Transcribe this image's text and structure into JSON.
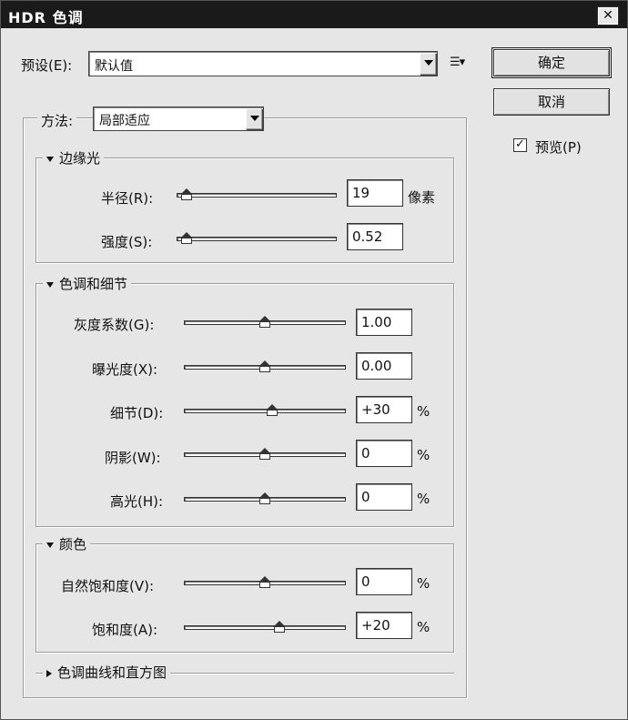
{
  "window": {
    "title": "HDR 色调",
    "close": "✕"
  },
  "preset": {
    "label": "预设(E):",
    "value": "默认值"
  },
  "buttons": {
    "ok": "确定",
    "cancel": "取消"
  },
  "preview": {
    "label": "预览(P)",
    "checked": true
  },
  "method": {
    "label": "方法:",
    "value": "局部适应"
  },
  "edge_glow": {
    "title": "边缘光",
    "radius": {
      "label": "半径(R):",
      "value": "19",
      "unit": "像素",
      "slider_fraction": 0.02
    },
    "strength": {
      "label": "强度(S):",
      "value": "0.52",
      "unit": "",
      "slider_fraction": 0.02
    }
  },
  "tone_detail": {
    "title": "色调和细节",
    "gamma": {
      "label": "灰度系数(G):",
      "value": "1.00",
      "unit": "",
      "slider_fraction": 0.5
    },
    "exposure": {
      "label": "曝光度(X):",
      "value": "0.00",
      "unit": "",
      "slider_fraction": 0.5
    },
    "detail": {
      "label": "细节(D):",
      "value": "+30",
      "unit": "%",
      "slider_fraction": 0.55
    },
    "shadow": {
      "label": "阴影(W):",
      "value": "0",
      "unit": "%",
      "slider_fraction": 0.5
    },
    "highlight": {
      "label": "高光(H):",
      "value": "0",
      "unit": "%",
      "slider_fraction": 0.5
    }
  },
  "color": {
    "title": "颜色",
    "vibrance": {
      "label": "自然饱和度(V):",
      "value": "0",
      "unit": "%",
      "slider_fraction": 0.5
    },
    "saturation": {
      "label": "饱和度(A):",
      "value": "+20",
      "unit": "%",
      "slider_fraction": 0.6
    }
  },
  "curve": {
    "title": "色调曲线和直方图"
  }
}
